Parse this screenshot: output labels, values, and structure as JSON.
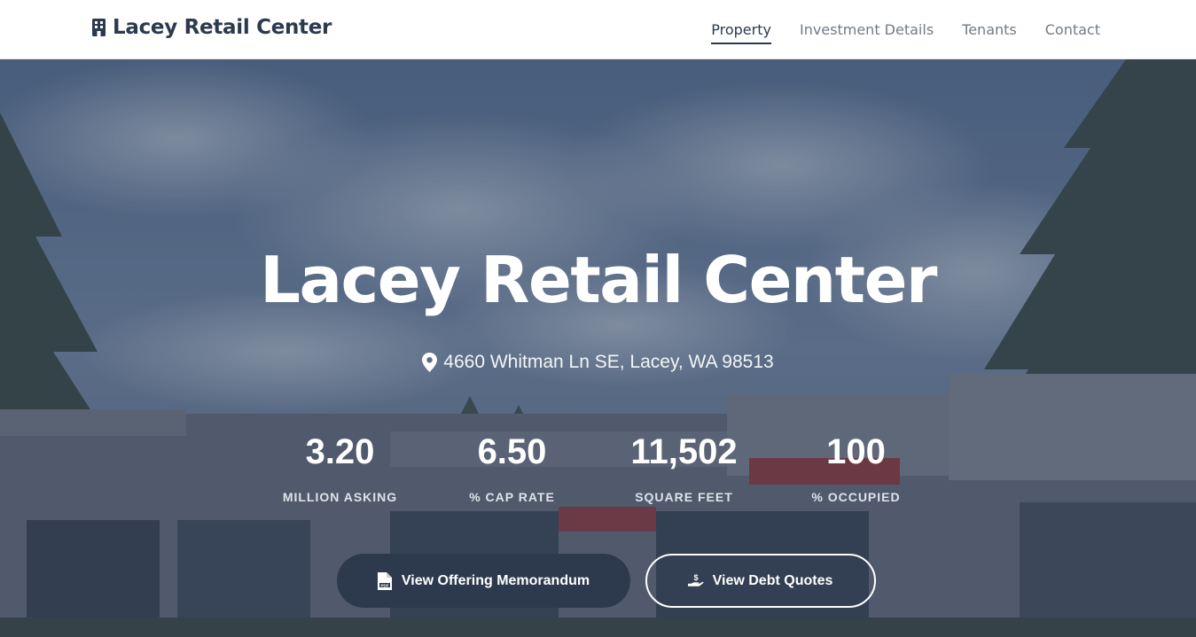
{
  "header": {
    "brand": "Lacey Retail Center",
    "brand_icon": "building-icon",
    "nav": [
      {
        "label": "Property",
        "active": true
      },
      {
        "label": "Investment Details",
        "active": false
      },
      {
        "label": "Tenants",
        "active": false
      },
      {
        "label": "Contact",
        "active": false
      }
    ]
  },
  "hero": {
    "title": "Lacey Retail Center",
    "address_icon": "map-pin-icon",
    "address": "4660 Whitman Ln SE, Lacey, WA 98513",
    "stats": [
      {
        "value": "3.20",
        "label": "MILLION ASKING"
      },
      {
        "value": "6.50",
        "label": "% CAP RATE"
      },
      {
        "value": "11,502",
        "label": "SQUARE FEET"
      },
      {
        "value": "100",
        "label": "% OCCUPIED"
      }
    ],
    "buttons": {
      "memorandum": {
        "label": "View Offering Memorandum",
        "icon": "file-pdf-icon"
      },
      "debt": {
        "label": "View Debt Quotes",
        "icon": "hand-holding-dollar-icon"
      }
    }
  },
  "colors": {
    "primary": "#2c3a4e",
    "nav_inactive": "#727b86",
    "overlay": "#283850"
  }
}
